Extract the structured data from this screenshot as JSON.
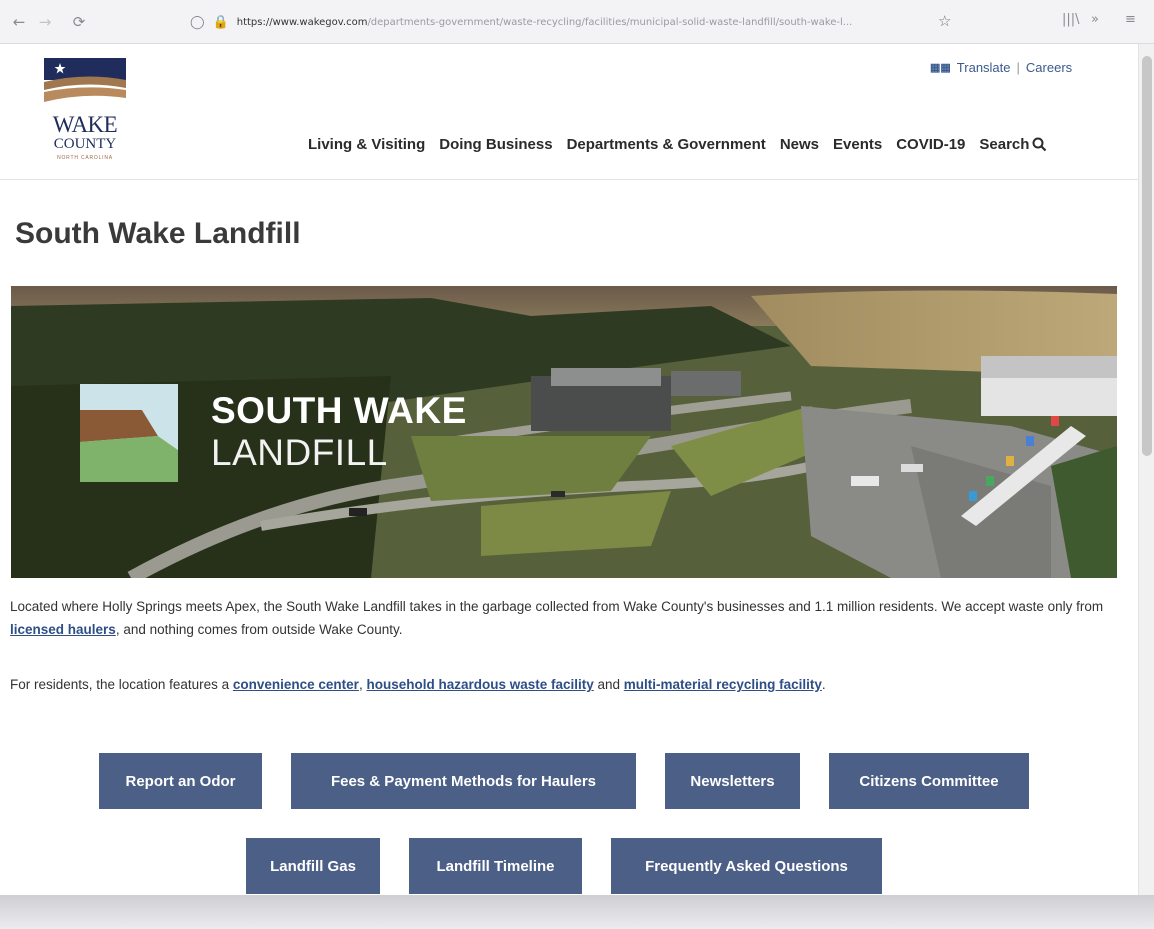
{
  "browser": {
    "url_host": "https://www.wakegov.com",
    "url_path": "/departments-government/waste-recycling/facilities/municipal-solid-waste-landfill/south-wake-l..."
  },
  "site": {
    "logo_line1": "WAKE",
    "logo_line2": "COUNTY",
    "logo_line3": "NORTH CAROLINA",
    "utility": {
      "translate": "Translate",
      "separator": "|",
      "careers": "Careers"
    },
    "nav": [
      "Living & Visiting",
      "Doing Business",
      "Departments & Government",
      "News",
      "Events",
      "COVID-19"
    ],
    "search_label": "Search"
  },
  "page": {
    "title": "South Wake Landfill",
    "hero": {
      "line1": "SOUTH WAKE",
      "line2": "LANDFILL"
    },
    "para1_a": "Located where Holly Springs meets Apex, the South Wake Landfill takes in the garbage collected from Wake County's businesses and 1.1 million residents. We accept waste only from ",
    "para1_link": "licensed haulers",
    "para1_b": ", and nothing comes from outside Wake County.",
    "para2_a": "For residents, the location features a ",
    "para2_link1": "convenience center",
    "para2_sep": ", ",
    "para2_link2": "household hazardous waste facility",
    "para2_and": " and ",
    "para2_link3": "multi-material recycling facility",
    "para2_end": ".",
    "buttons_row1": [
      "Report an Odor",
      "Fees & Payment Methods for Haulers",
      "Newsletters",
      "Citizens Committee"
    ],
    "buttons_row2": [
      "Landfill Gas",
      "Landfill Timeline",
      "Frequently Asked Questions"
    ]
  },
  "colors": {
    "button": "#4b5f87",
    "link": "#2e4e86",
    "logo_navy": "#1f2c5c"
  }
}
